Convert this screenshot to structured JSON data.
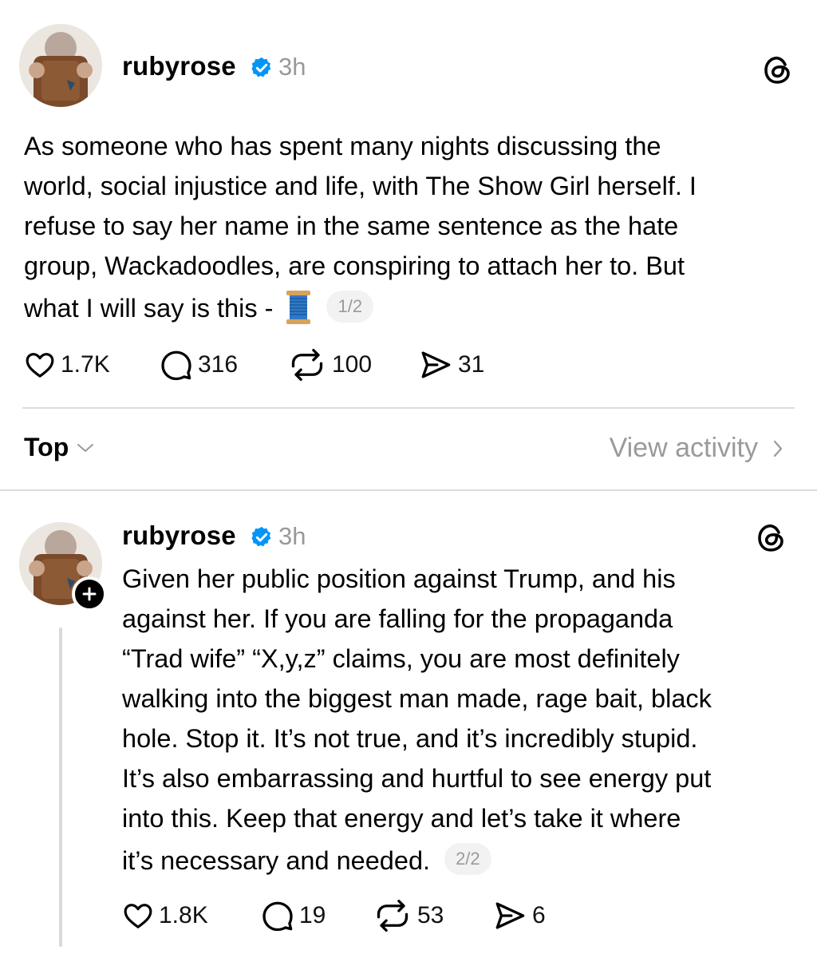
{
  "post1": {
    "username": "rubyrose",
    "time": "3h",
    "lines": [
      "As someone who has spent many nights discussing the",
      "world, social injustice and life, with The Show Girl herself. I",
      "refuse to say her name in the same sentence as the hate",
      "group, Wackadoodles, are conspiring to attach her to. But",
      "what I will say is this - "
    ],
    "emoji": "spool-of-thread",
    "page": "1/2",
    "likes": "1.7K",
    "replies": "316",
    "reposts": "100",
    "shares": "31"
  },
  "sort": {
    "label": "Top",
    "view_activity": "View activity"
  },
  "post2": {
    "username": "rubyrose",
    "time": "3h",
    "lines": [
      "Given her public position against Trump, and his",
      "against her. If you are falling for the propaganda",
      "“Trad wife” “X,y,z” claims, you are most definitely",
      "walking into the biggest man made, rage bait, black",
      "hole. Stop it. It’s not true, and it’s incredibly stupid.",
      "It’s also embarrassing and hurtful to see energy put",
      "into this. Keep that energy and let’s take it where",
      "it’s necessary and needed."
    ],
    "page": "2/2",
    "likes": "1.8K",
    "replies": "19",
    "reposts": "53",
    "shares": "6"
  },
  "colors": {
    "verified": "#0095f6",
    "muted": "#999999",
    "divider": "#dcdcdc"
  }
}
